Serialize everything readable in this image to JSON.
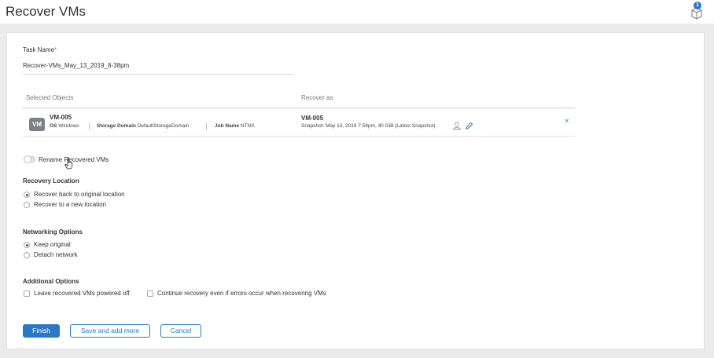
{
  "header": {
    "title": "Recover VMs",
    "notification_count": "1"
  },
  "task": {
    "label": "Task Name",
    "required_mark": "*",
    "value": "Recover-VMs_May_13_2019_8-38pm"
  },
  "table": {
    "col_objects": "Selected Objects",
    "col_recover_as": "Recover as",
    "row": {
      "badge": "VM",
      "name": "VM-005",
      "os_label": "OS",
      "os_value": "Windows",
      "storage_label": "Storage Domain",
      "storage_value": "DefaultStorageDomain",
      "job_label": "Job Name",
      "job_value": "NTNX",
      "recover_name": "VM-005",
      "snapshot": "Snapshot: May 13, 2019 7:59pm, 40 GiB (Latest Snapshot)",
      "remove": "×"
    }
  },
  "rename": {
    "label": "Rename Recovered VMs",
    "enabled": false
  },
  "recovery_location": {
    "title": "Recovery Location",
    "options": [
      "Recover back to original location",
      "Recover to a new location"
    ],
    "selected": 0
  },
  "networking": {
    "title": "Networking Options",
    "options": [
      "Keep original",
      "Detach network"
    ],
    "selected": 0
  },
  "additional": {
    "title": "Additional Options",
    "options": [
      "Leave recovered VMs powered off",
      "Continue recovery even if errors occur when recovering VMs"
    ]
  },
  "buttons": {
    "finish": "Finish",
    "save_more": "Save and add more",
    "cancel": "Cancel"
  },
  "colors": {
    "accent": "#2b78c9",
    "badge": "#7d8086"
  }
}
